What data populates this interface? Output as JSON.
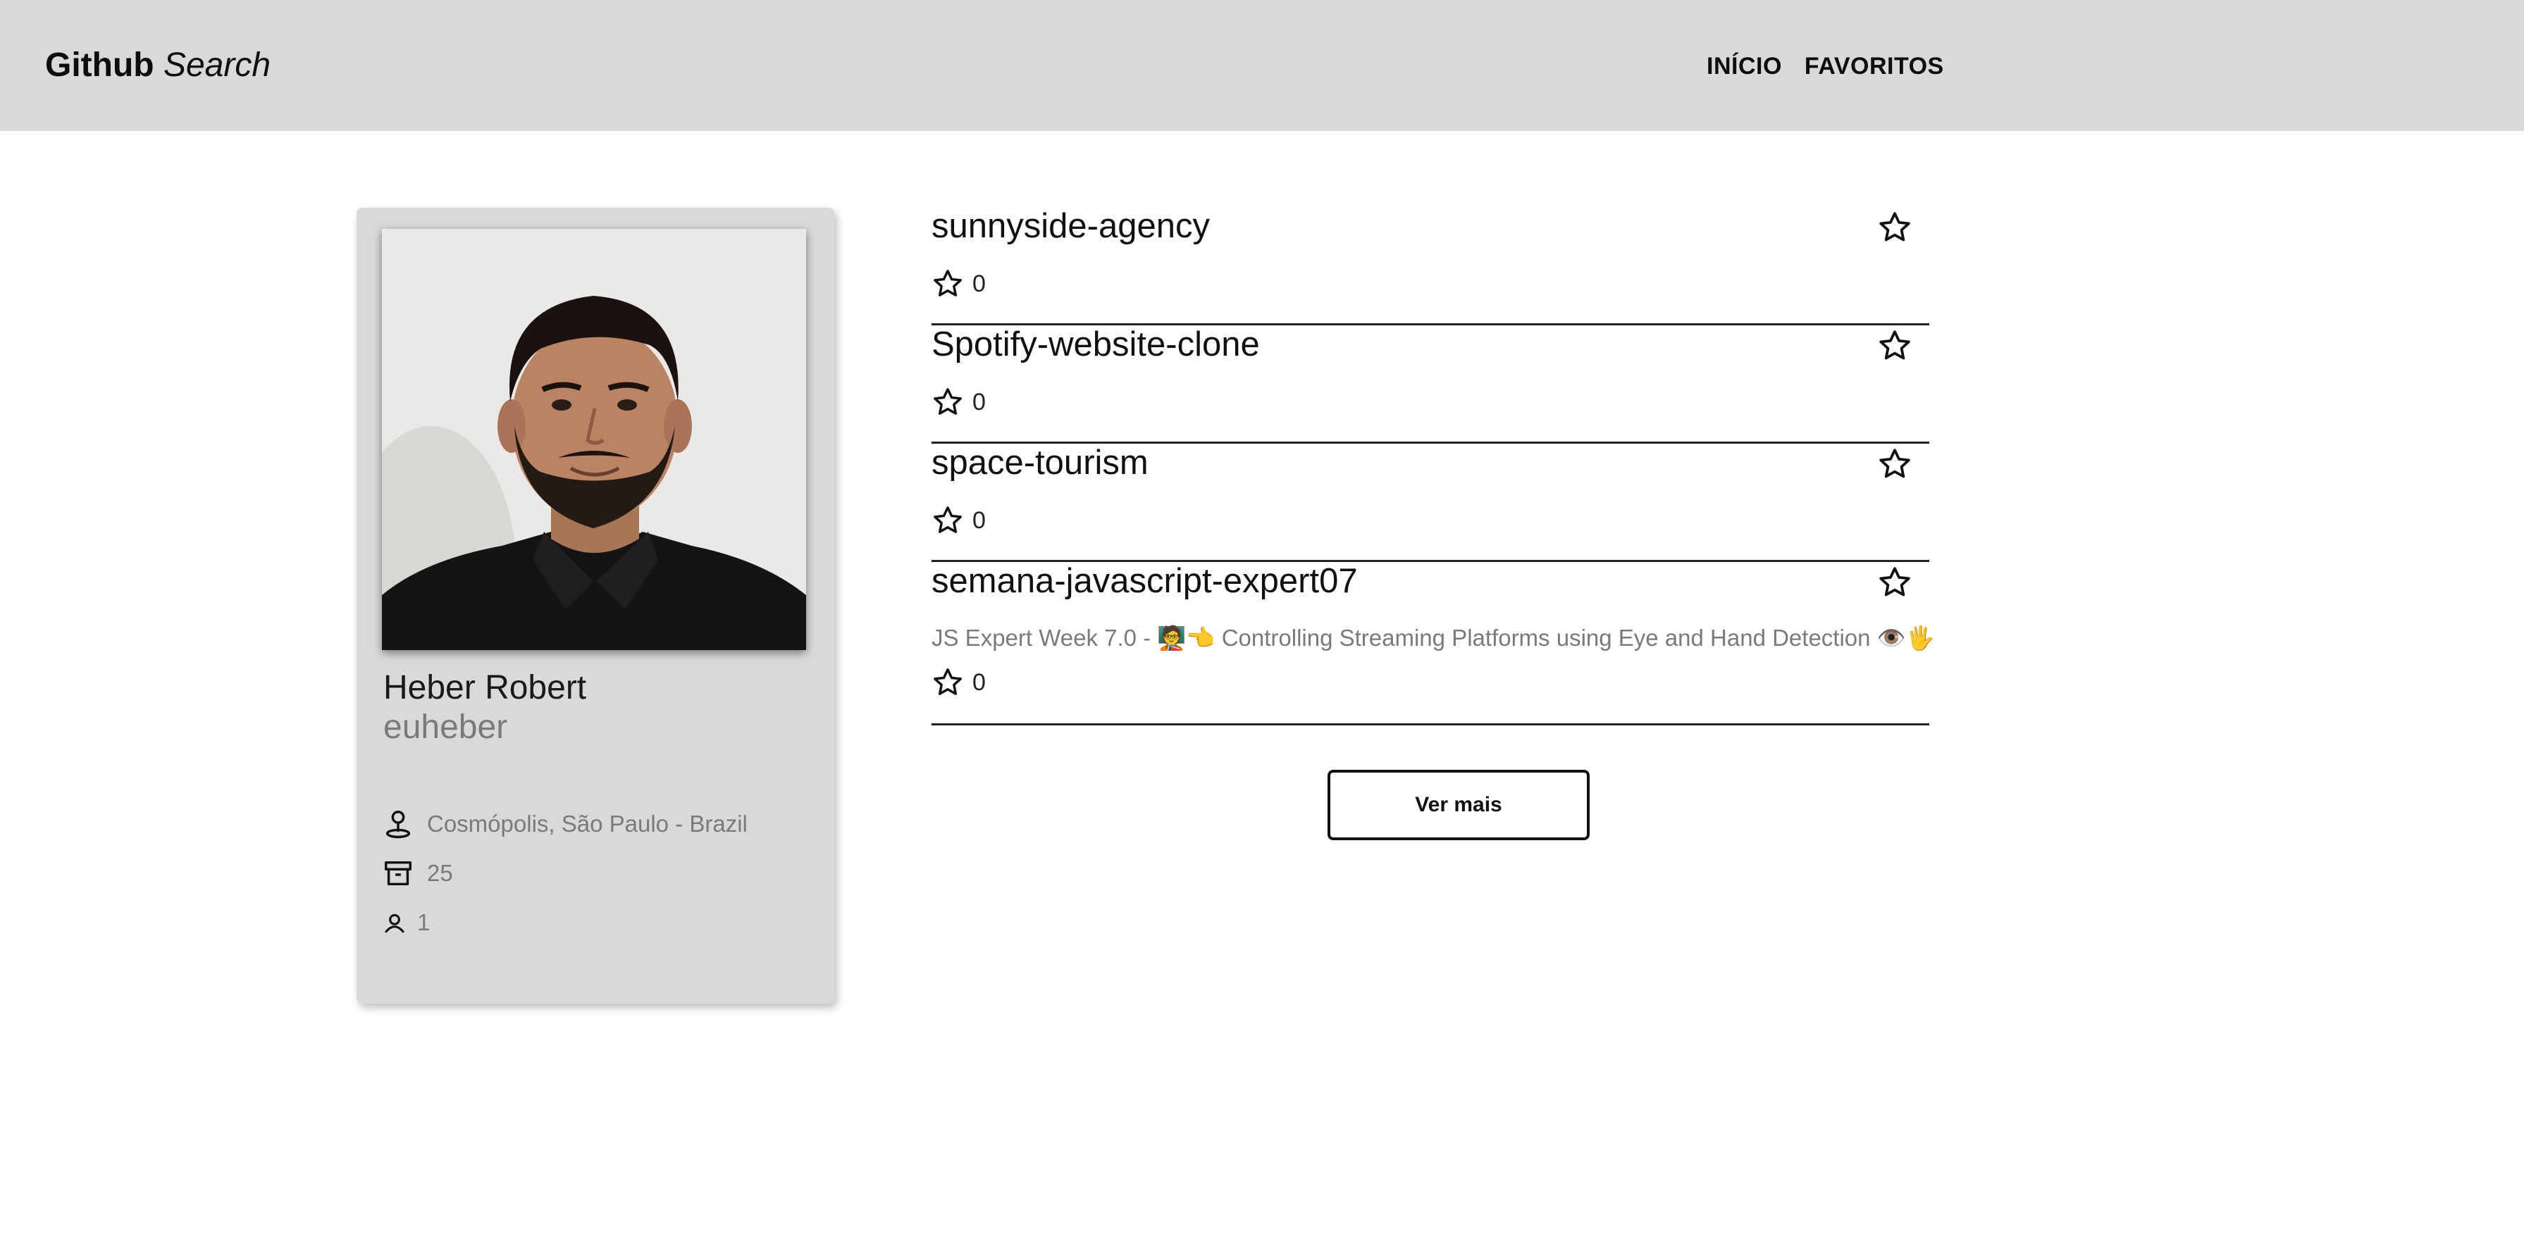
{
  "header": {
    "brand_bold": "Github",
    "brand_italic": "Search",
    "nav": [
      {
        "label": "INÍCIO"
      },
      {
        "label": "FAVORITOS"
      }
    ]
  },
  "profile": {
    "name": "Heber Robert",
    "login": "euheber",
    "location": "Cosmópolis, São Paulo - Brazil",
    "repos_count": "25",
    "followers_count": "1",
    "icons": {
      "location": "map-pin-icon",
      "repos": "archive-box-icon",
      "followers": "user-icon"
    }
  },
  "repos": [
    {
      "name": "sunnyside-agency",
      "description": "",
      "stars": "0"
    },
    {
      "name": "Spotify-website-clone",
      "description": "",
      "stars": "0"
    },
    {
      "name": "space-tourism",
      "description": "",
      "stars": "0"
    },
    {
      "name": "semana-javascript-expert07",
      "description": "JS Expert Week 7.0 - 🧑‍🏫👈 Controlling Streaming Platforms using Eye and Hand Detection 👁️🖐️",
      "stars": "0"
    }
  ],
  "load_more_label": "Ver mais",
  "colors": {
    "header_bg": "#d9d9d9",
    "card_bg": "#d9d9d9",
    "muted_text": "#7a7a7a",
    "divider": "#222222"
  }
}
